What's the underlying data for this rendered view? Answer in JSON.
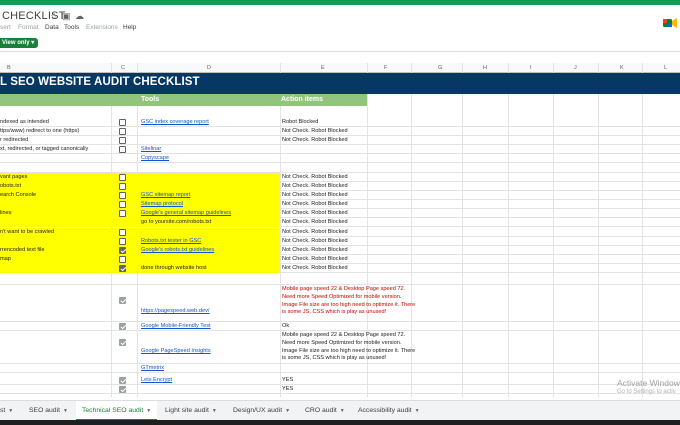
{
  "window": {
    "title": "CHECKLIST"
  },
  "menu": {
    "items": [
      "sert",
      "Format",
      "Data",
      "Tools",
      "Extensions",
      "Help"
    ]
  },
  "toolbar": {
    "view_only": "View only ▾"
  },
  "columns": [
    "B",
    "C",
    "D",
    "E",
    "F",
    "G",
    "H",
    "I",
    "J",
    "K",
    "L"
  ],
  "sheet": {
    "title": "L SEO WEBSITE AUDIT CHECKLIST",
    "header_tools": "Tools",
    "header_action": "Action items",
    "rows": [
      {
        "label": "ndexed as intended",
        "checked": false,
        "tool": "GSC index coverage report",
        "tool_link": true,
        "action": "Robot Blocked"
      },
      {
        "label": "ttps/www) redirect to one (https)",
        "checked": false,
        "tool": "",
        "action": "Not Check. Robot Blocked"
      },
      {
        "label": "r redirected",
        "checked": false,
        "tool": "",
        "action": "Not Check. Robot Blocked"
      },
      {
        "label": "xt, redirected, or tagged canonically",
        "checked": false,
        "tool": "Sitelinar",
        "tool_link": true,
        "action": ""
      },
      {
        "label": "",
        "checked": null,
        "tool": "Copyscape",
        "tool_link": true,
        "action": ""
      },
      {
        "label": "vant pages",
        "checked": false,
        "tool": "",
        "action": "Not Check. Robot Blocked",
        "yellow": true
      },
      {
        "label": "obots.txt",
        "checked": false,
        "tool": "",
        "action": "Not Check. Robot Blocked",
        "yellow": true
      },
      {
        "label": "earch Console",
        "checked": false,
        "tool": "GSC sitemap report",
        "tool_link": true,
        "action": "Not Check. Robot Blocked",
        "yellow": true
      },
      {
        "label": "",
        "checked": false,
        "tool": "Sitemap protocol",
        "tool_link": true,
        "action": "Not Check. Robot Blocked",
        "yellow": true
      },
      {
        "label": "lines",
        "checked": false,
        "tool": "Google's general sitemap guidelines",
        "tool_link": true,
        "action": "Not Check. Robot Blocked",
        "yellow": true
      },
      {
        "label": "",
        "checked": null,
        "tool": "go to yoursite.com/robots.txt",
        "tool_link": false,
        "action": "Not Check. Robot Blocked",
        "yellow": true
      },
      {
        "label": "n't want to be crawled",
        "checked": false,
        "tool": "",
        "action": "Not Check. Robot Blocked",
        "yellow": true
      },
      {
        "label": "",
        "checked": false,
        "tool": "Robots.txt tester in GSC",
        "tool_link": true,
        "action": "Not Check. Robot Blocked",
        "yellow": true
      },
      {
        "label": "rrencoded text file",
        "checked": true,
        "tool": "Google's robots.txt guidelines",
        "tool_link": true,
        "action": "Not Check. Robot Blocked",
        "yellow": true
      },
      {
        "label": "map",
        "checked": false,
        "tool": "",
        "action": "Not Check. Robot Blocked",
        "yellow": true
      },
      {
        "label": "",
        "checked": true,
        "tool": "done through website host",
        "tool_link": false,
        "action": "Not Check. Robot Blocked",
        "yellow": true
      }
    ],
    "perf_rows": [
      {
        "checked": true,
        "tool": "https://pagespeed.web.dev/",
        "action": "Mobile page speed 22 & Desktop Page speed 72. Need more Speed Optimized for mobile version. Image File size are too high need to optimize it. There is some JS, CSS which is play as unused!",
        "red": true
      },
      {
        "checked": true,
        "tool": "Google Mobile-Friendly Test",
        "action": "Ok",
        "red": false
      },
      {
        "checked": true,
        "tool": "Google PageSpeed Insights",
        "action": "Mobile page speed 22 & Desktop Page speed 72. Need more Speed Optimized for mobile version. Image File size are too high need to optimize it. There is some JS, CSS which is play as unused!",
        "red": false
      },
      {
        "checked": null,
        "tool": "GTmetrix",
        "action": "",
        "red": false
      },
      {
        "checked": true,
        "tool": "Lets Encrypt",
        "action": "YES",
        "red": false
      },
      {
        "checked": true,
        "tool": "",
        "action": "YES",
        "red": false
      }
    ]
  },
  "tabs": [
    {
      "label": "st",
      "active": false
    },
    {
      "label": "SEO audit",
      "active": false
    },
    {
      "label": "Technical SEO audit",
      "active": true
    },
    {
      "label": "Light site audit",
      "active": false
    },
    {
      "label": "Design/UX audit",
      "active": false
    },
    {
      "label": "CRO audit",
      "active": false
    },
    {
      "label": "Accessibility audit",
      "active": false
    }
  ],
  "watermark": {
    "line1": "Activate Window",
    "line2": "Go to Settings to activ"
  },
  "colors": {
    "banner": "#073763",
    "header": "#93c47d",
    "highlight": "#ffff00",
    "accent": "#188038"
  }
}
